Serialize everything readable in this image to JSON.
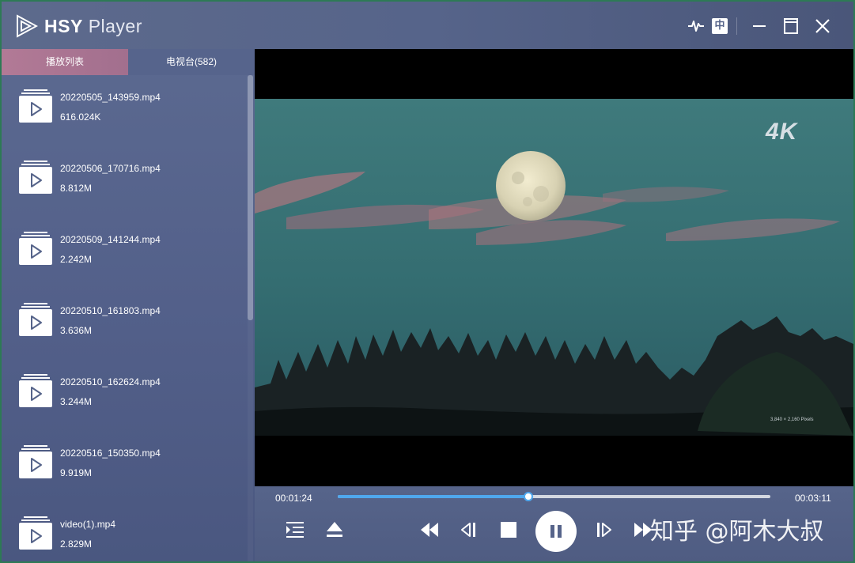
{
  "app": {
    "title_bold": "HSY",
    "title_light": "Player",
    "toolbar_icons": [
      "waveform-icon",
      "subtitle-icon",
      "minimize-icon",
      "maximize-icon",
      "close-icon"
    ],
    "subtitle_label": "中"
  },
  "sidebar": {
    "tabs": [
      {
        "label": "播放列表",
        "active": true
      },
      {
        "label": "电视台(582)",
        "active": false
      }
    ],
    "items": [
      {
        "name": "20220505_143959.mp4",
        "size": "616.024K"
      },
      {
        "name": "20220506_170716.mp4",
        "size": "8.812M"
      },
      {
        "name": "20220509_141244.mp4",
        "size": "2.242M"
      },
      {
        "name": "20220510_161803.mp4",
        "size": "3.636M"
      },
      {
        "name": "20220510_162624.mp4",
        "size": "3.244M"
      },
      {
        "name": "20220516_150350.mp4",
        "size": "9.919M"
      },
      {
        "name": "video(1).mp4",
        "size": "2.829M"
      }
    ]
  },
  "video": {
    "badge": "4K",
    "resolution_caption": "3,840 × 2,160 Pixels"
  },
  "controls": {
    "current_time": "00:01:24",
    "total_time": "00:03:11",
    "progress": 0.44,
    "watermark": "知乎 @阿木大叔",
    "buttons": [
      "playlist-icon",
      "eject-icon",
      "rewind-icon",
      "previous-frame-icon",
      "stop-icon",
      "pause-icon",
      "next-frame-icon",
      "fast-forward-icon"
    ]
  },
  "colors": {
    "accent": "#4fa8ee",
    "active_tab": "#b27a96",
    "window_border": "#2d7a55"
  }
}
